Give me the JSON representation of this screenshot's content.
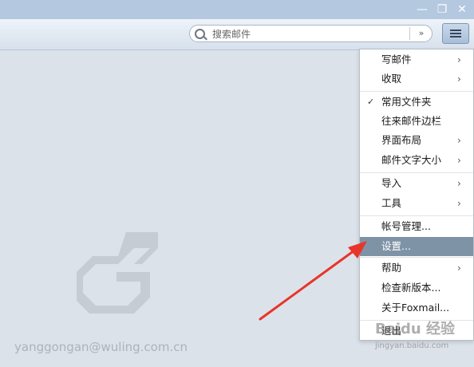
{
  "window": {
    "minimize_glyph": "—",
    "restore_glyph": "❐",
    "close_glyph": "✕"
  },
  "search": {
    "placeholder": "搜索邮件",
    "dropdown_glyph": "»"
  },
  "menu": {
    "groups": [
      [
        {
          "label": "写邮件",
          "has_submenu": true
        },
        {
          "label": "收取",
          "has_submenu": true
        }
      ],
      [
        {
          "label": "常用文件夹",
          "checked": true
        },
        {
          "label": "往来邮件边栏"
        },
        {
          "label": "界面布局",
          "has_submenu": true
        },
        {
          "label": "邮件文字大小",
          "has_submenu": true
        }
      ],
      [
        {
          "label": "导入",
          "has_submenu": true
        },
        {
          "label": "工具",
          "has_submenu": true
        }
      ],
      [
        {
          "label": "帐号管理..."
        },
        {
          "label": "设置...",
          "selected": true
        }
      ],
      [
        {
          "label": "帮助",
          "has_submenu": true
        },
        {
          "label": "检查新版本..."
        },
        {
          "label": "关于Foxmail..."
        }
      ],
      [
        {
          "label": "退出"
        }
      ]
    ],
    "check_glyph": "✓",
    "arrow_glyph": "›",
    "selected_color": "#7f93a6"
  },
  "footer": {
    "account_email": "yanggongan@wuling.com.cn"
  },
  "watermark": {
    "brand": "Baidu 经验",
    "site": "jingyan.baidu.com"
  },
  "colors": {
    "annotation_arrow": "#e8352b",
    "titlebar": "#b4c8e0"
  },
  "icons": {
    "search": "search-icon",
    "menu": "hamburger-menu-icon",
    "logo": "foxmail-logo-icon"
  }
}
